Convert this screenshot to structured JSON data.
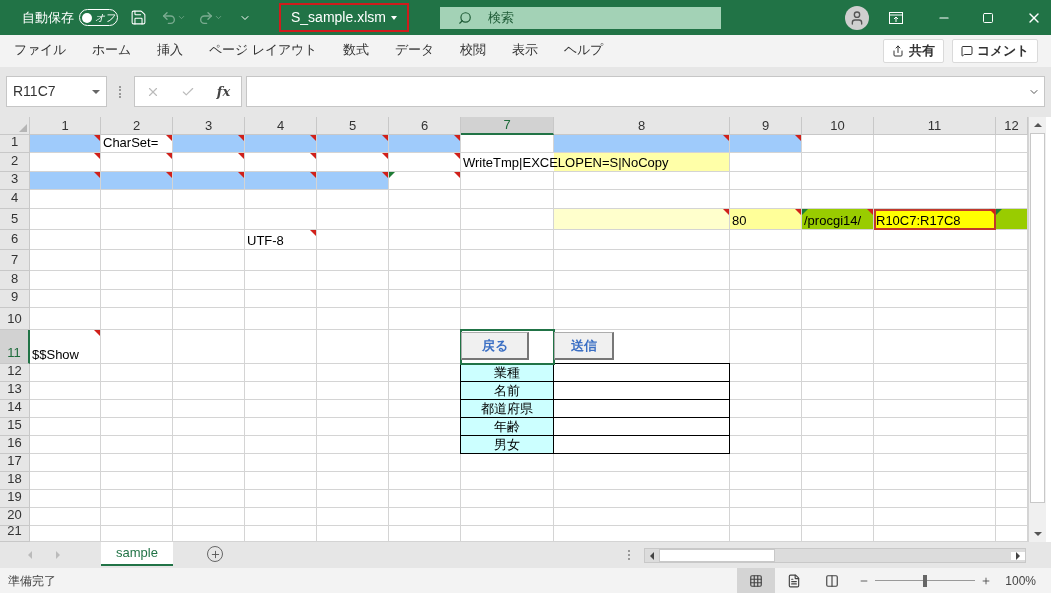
{
  "title_bar": {
    "autosave_label": "自動保存",
    "autosave_toggle": {
      "label": "オフ",
      "on": false
    },
    "file_name": {
      "text": "S_sample.xlsm",
      "highlighted": true
    },
    "search_placeholder": "検索"
  },
  "ribbon_tabs": [
    {
      "label": "ファイル",
      "selected": false
    },
    {
      "label": "ホーム",
      "selected": false
    },
    {
      "label": "挿入",
      "selected": false
    },
    {
      "label": "ページ レイアウト",
      "selected": false
    },
    {
      "label": "数式",
      "selected": false
    },
    {
      "label": "データ",
      "selected": false
    },
    {
      "label": "校閲",
      "selected": false
    },
    {
      "label": "表示",
      "selected": false
    },
    {
      "label": "ヘルプ",
      "selected": false
    }
  ],
  "share_button": "共有",
  "comment_button": "コメント",
  "formula_bar": {
    "name_box": "R11C7",
    "function_label": "fx"
  },
  "columns": [
    {
      "label": "1",
      "selected": false
    },
    {
      "label": "2",
      "selected": false
    },
    {
      "label": "3",
      "selected": false
    },
    {
      "label": "4",
      "selected": false
    },
    {
      "label": "5",
      "selected": false
    },
    {
      "label": "6",
      "selected": false
    },
    {
      "label": "7",
      "selected": true
    },
    {
      "label": "8",
      "selected": false
    },
    {
      "label": "9",
      "selected": false
    },
    {
      "label": "10",
      "selected": false
    },
    {
      "label": "11",
      "selected": false
    },
    {
      "label": "12",
      "selected": false
    }
  ],
  "rows": [
    {
      "label": "1",
      "selected": false,
      "cells": [
        {
          "color": "#9fcbfb",
          "comment": true
        },
        {
          "text": "CharSet=",
          "comment": true
        },
        {
          "color": "#9fcbfb",
          "comment": true
        },
        {
          "color": "#9fcbfb",
          "comment": true
        },
        {
          "color": "#9fcbfb",
          "comment": true
        },
        {
          "color": "#9fcbfb",
          "comment": true
        },
        {},
        {
          "color": "#9fcbfb",
          "comment": true
        },
        {
          "color": "#9fcbfb",
          "comment": true
        }
      ]
    },
    {
      "label": "2",
      "selected": false,
      "cells": [
        {
          "comment": true
        },
        {
          "comment": true
        },
        {
          "comment": true
        },
        {
          "comment": true
        },
        {
          "comment": true
        },
        {
          "comment": true
        },
        {
          "text": "WriteTmp|EXCELOPEN=S|NoCopy",
          "spills": true
        },
        {
          "color": "#ffffa8"
        }
      ]
    },
    {
      "label": "3",
      "selected": false,
      "cells": [
        {
          "color": "#9fcbfb",
          "comment": true
        },
        {
          "color": "#9fcbfb",
          "comment": true
        },
        {
          "color": "#9fcbfb",
          "comment": true
        },
        {
          "color": "#9fcbfb",
          "comment": true
        },
        {
          "color": "#9fcbfb",
          "comment": true
        },
        {
          "comment": true,
          "error_mark": true
        }
      ]
    },
    {
      "label": "4",
      "selected": false
    },
    {
      "label": "5",
      "selected": false,
      "cells": [
        {},
        {},
        {},
        {},
        {},
        {},
        {},
        {
          "color": "#ffffcc",
          "comment": true
        },
        {
          "text": "80",
          "color": "#ffff99",
          "comment": true
        },
        {
          "text": "/procgi14/",
          "color": "#99cc00",
          "comment": true,
          "error_mark": true
        },
        {
          "text": "R10C7:R17C8",
          "color": "#ffff00",
          "comment": true,
          "highlighted": true
        },
        {
          "color": "#99cc00",
          "error_mark": true
        }
      ]
    },
    {
      "label": "6",
      "selected": false,
      "cells": [
        {},
        {},
        {},
        {
          "text": "UTF-8",
          "comment": true
        }
      ]
    },
    {
      "label": "7",
      "selected": false
    },
    {
      "label": "8",
      "selected": false
    },
    {
      "label": "9",
      "selected": false
    },
    {
      "label": "10",
      "selected": false
    },
    {
      "label": "11",
      "selected": true,
      "cells": [
        {
          "text": "$$Show",
          "comment": true
        },
        {},
        {},
        {},
        {},
        {},
        {
          "active": true,
          "button": "戻る"
        },
        {
          "button": "送信"
        }
      ]
    },
    {
      "label": "12",
      "selected": false,
      "cells": [
        {},
        {},
        {},
        {},
        {},
        {},
        {
          "text": "業種",
          "color": "#ccffff",
          "bordered": true,
          "centered": true
        },
        {
          "bordered": true
        }
      ]
    },
    {
      "label": "13",
      "selected": false,
      "cells": [
        {},
        {},
        {},
        {},
        {},
        {},
        {
          "text": "名前",
          "color": "#ccffff",
          "bordered": true,
          "centered": true
        },
        {
          "bordered": true
        }
      ]
    },
    {
      "label": "14",
      "selected": false,
      "cells": [
        {},
        {},
        {},
        {},
        {},
        {},
        {
          "text": "都道府県",
          "color": "#ccffff",
          "bordered": true,
          "centered": true
        },
        {
          "bordered": true
        }
      ]
    },
    {
      "label": "15",
      "selected": false,
      "cells": [
        {},
        {},
        {},
        {},
        {},
        {},
        {
          "text": "年齢",
          "color": "#ccffff",
          "bordered": true,
          "centered": true
        },
        {
          "bordered": true
        }
      ]
    },
    {
      "label": "16",
      "selected": false,
      "cells": [
        {},
        {},
        {},
        {},
        {},
        {},
        {
          "text": "男女",
          "color": "#ccffff",
          "bordered": true,
          "centered": true
        },
        {
          "bordered": true
        }
      ]
    },
    {
      "label": "17",
      "selected": false
    },
    {
      "label": "18",
      "selected": false
    },
    {
      "label": "19",
      "selected": false
    },
    {
      "label": "20",
      "selected": false
    },
    {
      "label": "21",
      "selected": false
    }
  ],
  "sheet_tabs": [
    {
      "label": "sample",
      "selected": true
    }
  ],
  "status_bar": {
    "text": "準備完了",
    "view_modes": [
      {
        "selected": true
      },
      {
        "selected": false
      },
      {
        "selected": false
      }
    ],
    "zoom": {
      "level": 0.5,
      "reading": "100%"
    }
  }
}
